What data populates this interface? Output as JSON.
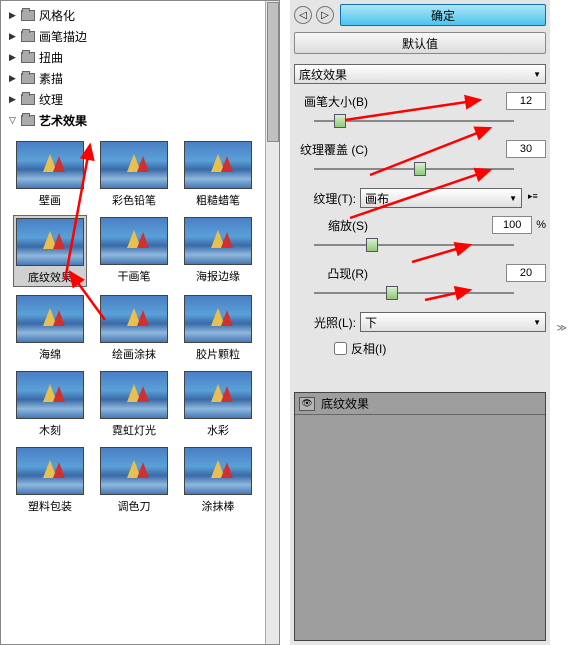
{
  "tree": {
    "items": [
      {
        "label": "风格化",
        "expanded": false
      },
      {
        "label": "画笔描边",
        "expanded": false
      },
      {
        "label": "扭曲",
        "expanded": false
      },
      {
        "label": "素描",
        "expanded": false
      },
      {
        "label": "纹理",
        "expanded": false
      },
      {
        "label": "艺术效果",
        "expanded": true
      }
    ]
  },
  "thumbs": [
    {
      "label": "壁画"
    },
    {
      "label": "彩色铅笔"
    },
    {
      "label": "粗糙蜡笔"
    },
    {
      "label": "底纹效果"
    },
    {
      "label": "干画笔"
    },
    {
      "label": "海报边缘"
    },
    {
      "label": "海绵"
    },
    {
      "label": "绘画涂抹"
    },
    {
      "label": "胶片颗粒"
    },
    {
      "label": "木刻"
    },
    {
      "label": "霓虹灯光"
    },
    {
      "label": "水彩"
    },
    {
      "label": "塑料包装"
    },
    {
      "label": "调色刀"
    },
    {
      "label": "涂抹棒"
    }
  ],
  "selected_thumb": 3,
  "buttons": {
    "ok": "确定",
    "default": "默认值"
  },
  "main_dd": "底纹效果",
  "sliders": {
    "brush": {
      "label": "画笔大小(B)",
      "val": "12",
      "pos": 20
    },
    "cover": {
      "label": "纹理覆盖 (C)",
      "val": "30",
      "pos": 100
    },
    "zoom": {
      "label": "缩放(S)",
      "val": "100",
      "pos": 52,
      "pct": "%"
    },
    "relief": {
      "label": "凸现(R)",
      "val": "20",
      "pos": 72
    }
  },
  "texture": {
    "label": "纹理(T):",
    "val": "画布"
  },
  "light": {
    "label": "光照(L):",
    "val": "下"
  },
  "invert": "反相(I)",
  "effect_item": "底纹效果"
}
